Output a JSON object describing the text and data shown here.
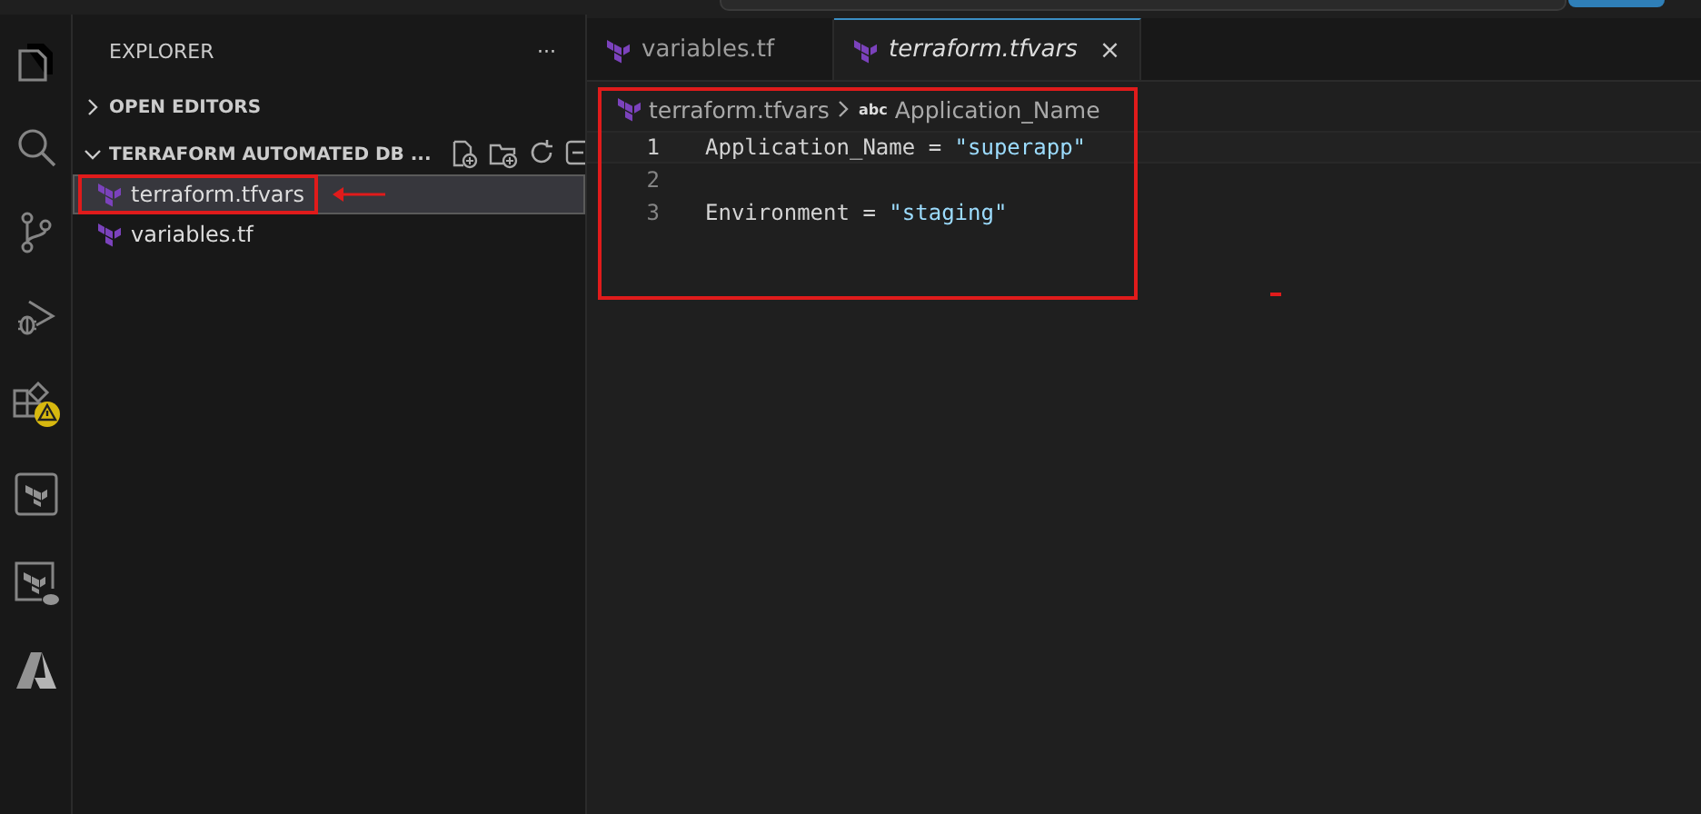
{
  "activity_bar": [
    {
      "kind": "files",
      "selected": false
    },
    {
      "kind": "search",
      "selected": false
    },
    {
      "kind": "source-control",
      "selected": false
    },
    {
      "kind": "run-debug",
      "selected": false
    },
    {
      "kind": "extensions",
      "selected": false
    },
    {
      "kind": "terraform",
      "selected": false
    },
    {
      "kind": "terraform-cloud",
      "selected": false
    },
    {
      "kind": "azure",
      "selected": false
    }
  ],
  "sidebar": {
    "title": "EXPLORER",
    "more": "···",
    "sections": [
      {
        "label": "OPEN EDITORS",
        "expanded": false
      },
      {
        "label": "TERRAFORM AUTOMATED DB ...",
        "expanded": true,
        "items": [
          {
            "label": "terraform.tfvars",
            "selected": true
          },
          {
            "label": "variables.tf",
            "selected": false
          }
        ]
      }
    ]
  },
  "tabs": [
    {
      "label": "variables.tf",
      "selected": false
    },
    {
      "label": "terraform.tfvars",
      "selected": true,
      "close": "×"
    }
  ],
  "breadcrumb": {
    "file": "terraform.tfvars",
    "symbol_badge": "abc",
    "symbol": "Application_Name"
  },
  "code": [
    {
      "number": "1",
      "tokens": [
        {
          "kind": "key",
          "text": "Application_Name"
        },
        {
          "kind": "op",
          "text": " = "
        },
        {
          "kind": "string",
          "text": "\"superapp\""
        }
      ]
    },
    {
      "number": "2"
    },
    {
      "number": "3",
      "tokens": [
        {
          "kind": "key",
          "text": "Environment"
        },
        {
          "kind": "op",
          "text": " = "
        },
        {
          "kind": "string",
          "text": "\"staging\""
        }
      ]
    }
  ]
}
